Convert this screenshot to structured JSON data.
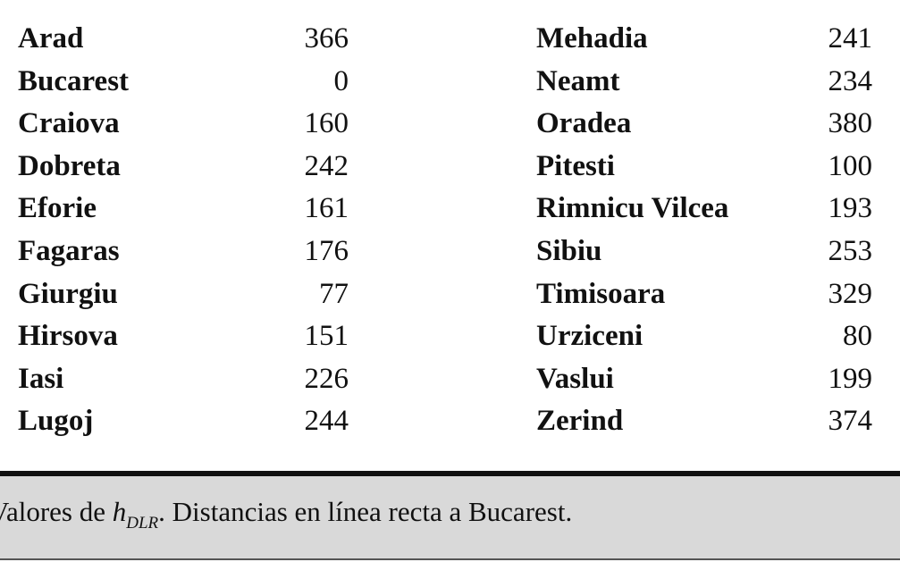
{
  "table": {
    "left": [
      {
        "name": "Arad",
        "value": "366"
      },
      {
        "name": "Bucarest",
        "value": "0"
      },
      {
        "name": "Craiova",
        "value": "160"
      },
      {
        "name": "Dobreta",
        "value": "242"
      },
      {
        "name": "Eforie",
        "value": "161"
      },
      {
        "name": "Fagaras",
        "value": "176"
      },
      {
        "name": "Giurgiu",
        "value": "77"
      },
      {
        "name": "Hirsova",
        "value": "151"
      },
      {
        "name": "Iasi",
        "value": "226"
      },
      {
        "name": "Lugoj",
        "value": "244"
      }
    ],
    "right": [
      {
        "name": "Mehadia",
        "value": "241"
      },
      {
        "name": "Neamt",
        "value": "234"
      },
      {
        "name": "Oradea",
        "value": "380"
      },
      {
        "name": "Pitesti",
        "value": "100"
      },
      {
        "name": "Rimnicu Vilcea",
        "value": "193"
      },
      {
        "name": "Sibiu",
        "value": "253"
      },
      {
        "name": "Timisoara",
        "value": "329"
      },
      {
        "name": "Urziceni",
        "value": "80"
      },
      {
        "name": "Vaslui",
        "value": "199"
      },
      {
        "name": "Zerind",
        "value": "374"
      }
    ]
  },
  "caption": {
    "prefix": "Valores de ",
    "symbol": "h",
    "subscript": "DLR",
    "suffix": ". Distancias en línea recta a Bucarest."
  }
}
